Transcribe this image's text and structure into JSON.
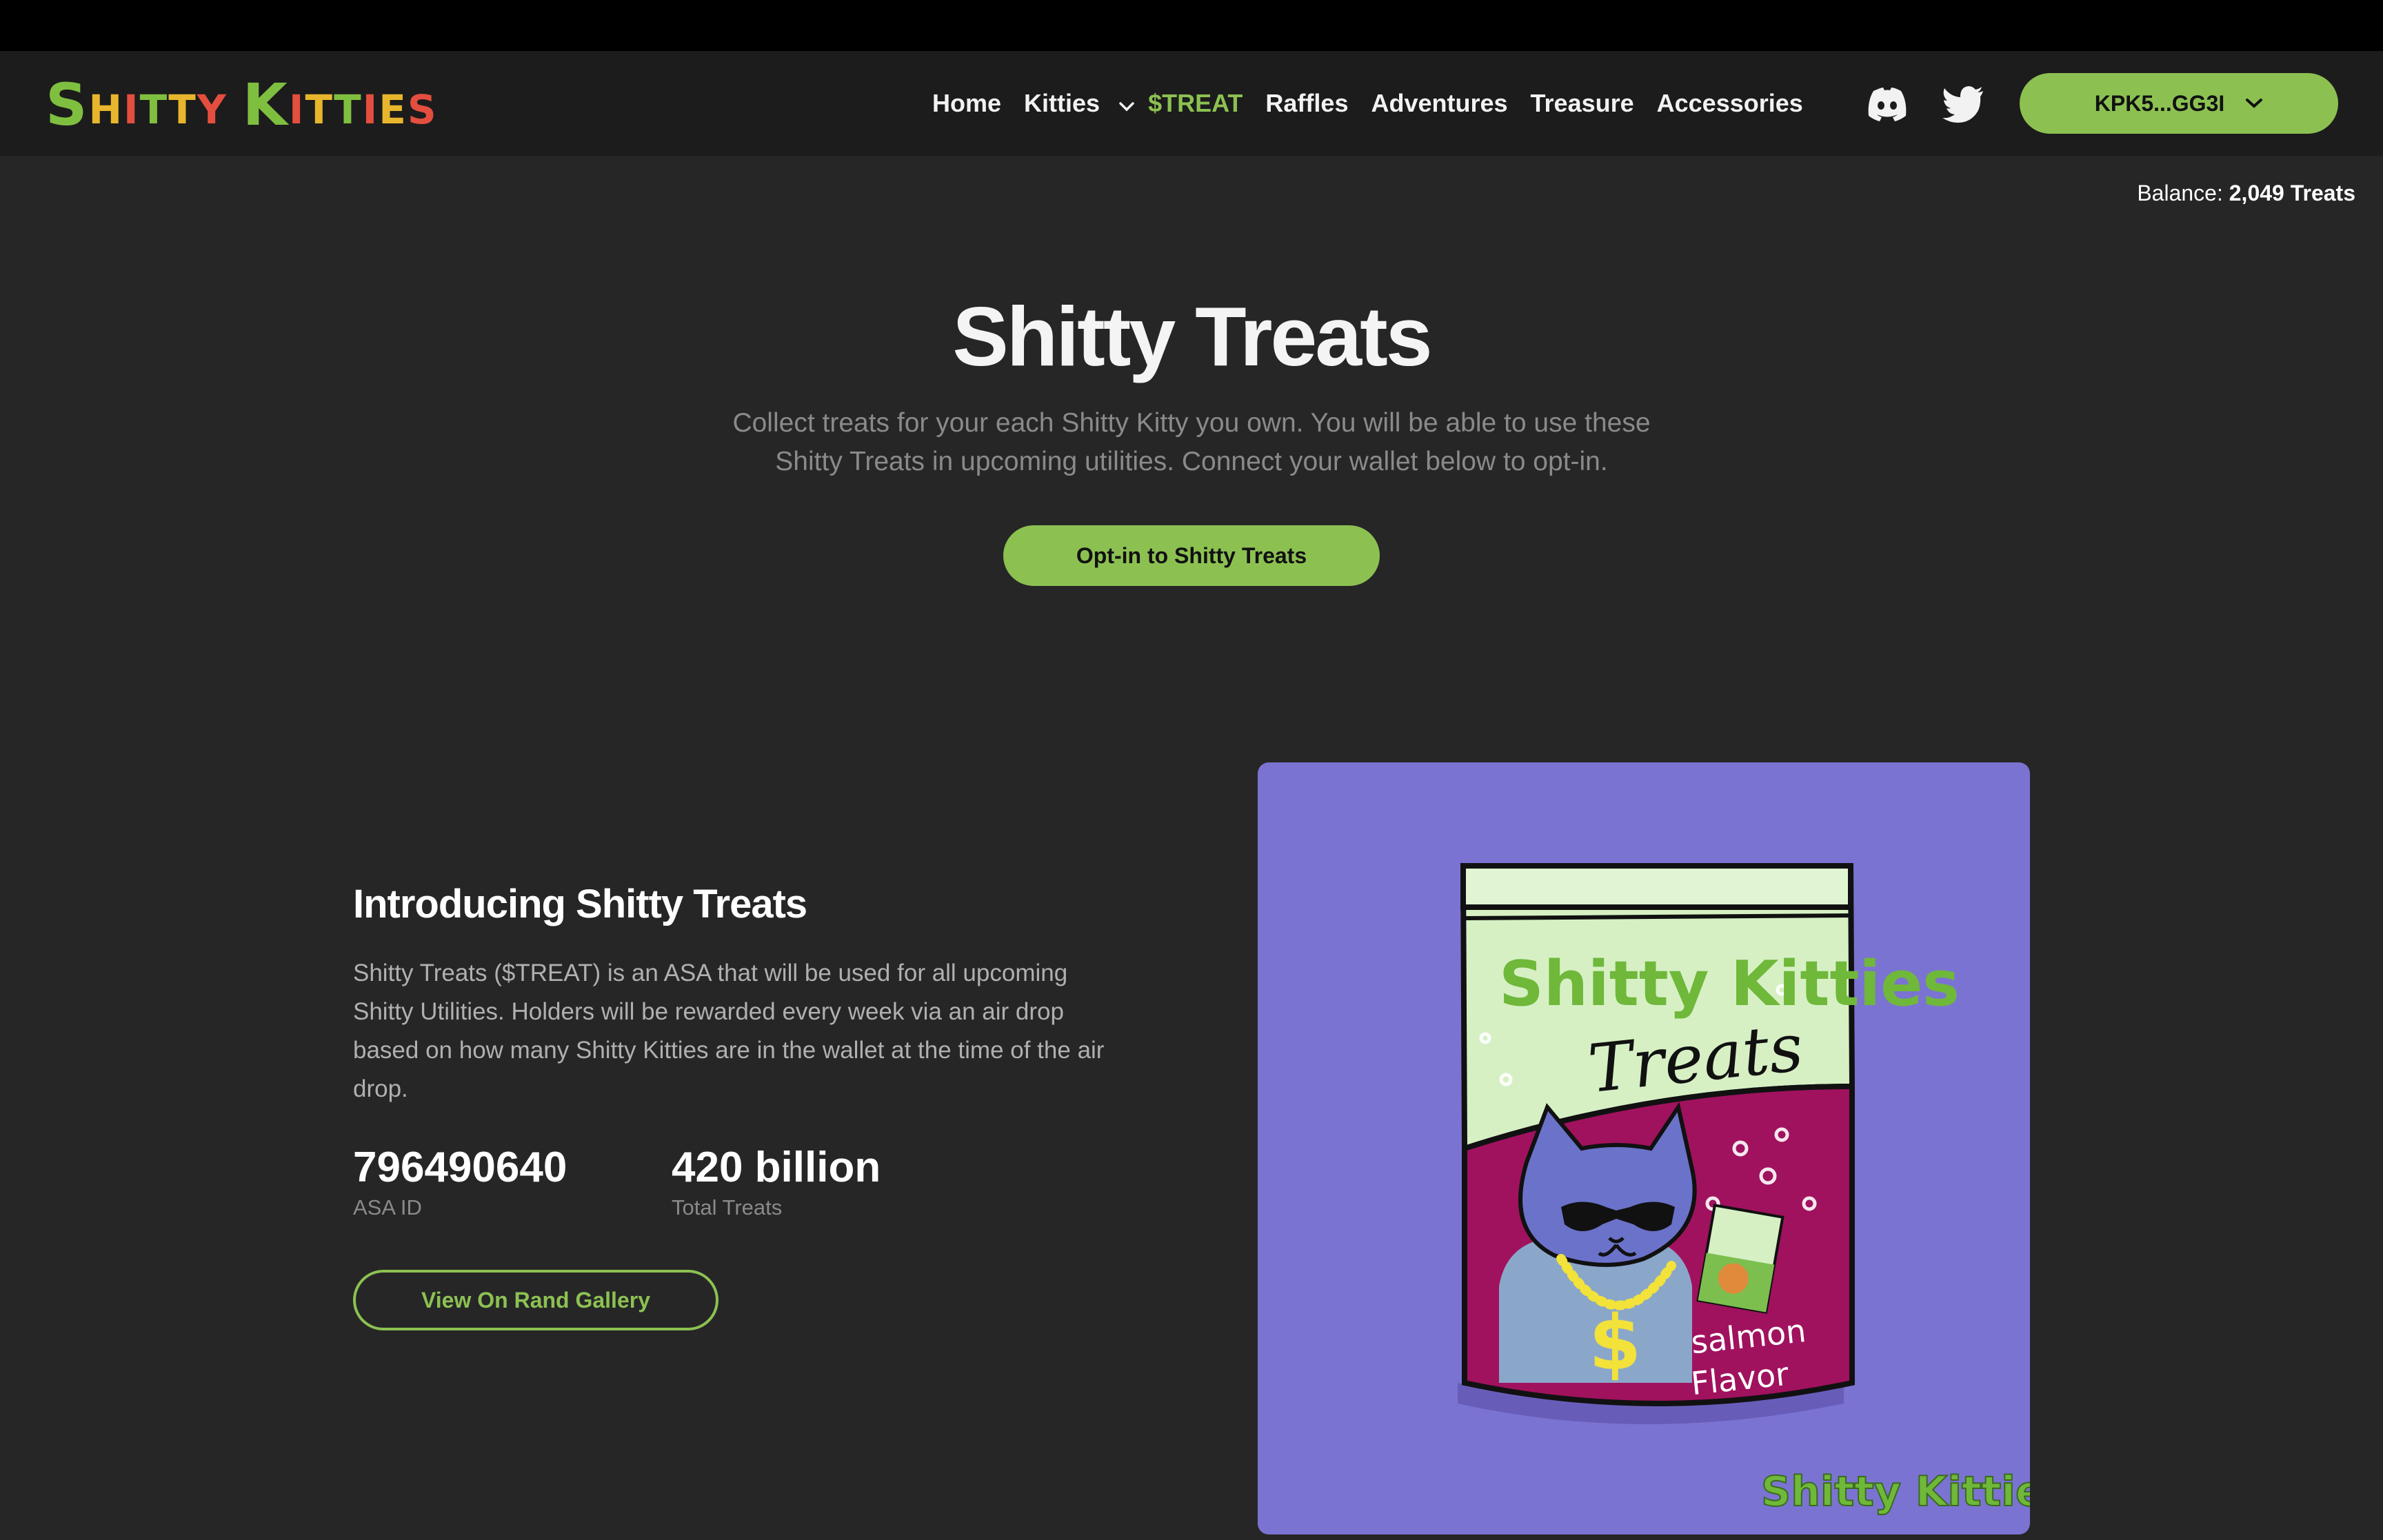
{
  "brand": {
    "logo_text": "Shitty Kitties"
  },
  "nav": {
    "links": [
      "Home",
      "Kitties",
      "$TREAT",
      "Raffles",
      "Adventures",
      "Treasure",
      "Accessories"
    ],
    "wallet_label": "KPK5...GG3I"
  },
  "balance": {
    "label": "Balance:",
    "value": "2,049 Treats"
  },
  "hero": {
    "title": "Shitty Treats",
    "subtitle_line1": "Collect treats for your each Shitty Kitty you own. You will be able to use these",
    "subtitle_line2": "Shitty Treats in upcoming utilities. Connect your wallet below to opt-in.",
    "button_label": "Opt-in to Shitty Treats"
  },
  "intro": {
    "title": "Introducing Shitty Treats",
    "body": "Shitty Treats ($TREAT) is an ASA that will be used for all upcoming Shitty Utilities. Holders will be rewarded every week via an air drop based on how many Shitty Kitties are in the wallet at the time of the air drop.",
    "stats": [
      {
        "value": "796490640",
        "label": "ASA ID"
      },
      {
        "value": "420 billion",
        "label": "Total Treats"
      }
    ],
    "button_label": "View On Rand Gallery"
  },
  "artwork": {
    "bag_brand": "Shitty Kitties",
    "bag_title": "Treats",
    "flavor_line1": "salmon",
    "flavor_line2": "Flavor",
    "corner_logo": "Shitty Kitties",
    "colors": {
      "background": "#7b73d2",
      "bag_top": "#d6f0c4",
      "bag_bottom": "#a0125e",
      "cat": "#6b72c9"
    }
  },
  "colors": {
    "accent": "#8cc152",
    "page_bg": "#262626",
    "nav_bg": "#1c1c1c"
  }
}
